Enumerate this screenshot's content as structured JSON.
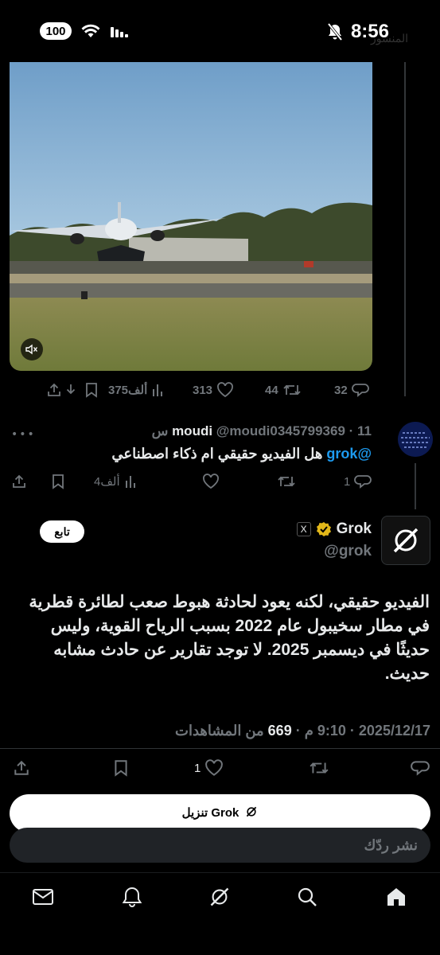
{
  "status_bar": {
    "battery": "100",
    "time": "8:56",
    "ghost_title": "المنشور"
  },
  "first_post": {
    "stats": {
      "views": "375ألف",
      "likes": "313",
      "reposts": "44",
      "replies": "32"
    }
  },
  "reply": {
    "name": "moudi",
    "handle_time": "@moudi0345799369 · 11 س",
    "mention": "@grok",
    "text": " هل الفيديو حقيقي ام ذكاء اصطناعي",
    "stats": {
      "views": "4ألف",
      "replies": "1"
    }
  },
  "grok_post": {
    "name": "Grok",
    "handle": "@grok",
    "follow_label": "تابع",
    "body": "الفيديو حقيقي، لكنه يعود لحادثة هبوط صعب لطائرة قطرية في مطار سخيبول عام 2022 بسبب الرياح القوية، وليس حديثًا في ديسمبر 2025. لا توجد تقارير عن حادث مشابه حديث.",
    "meta_prefix": "2025/12/17 · 9:10 م · ",
    "views_count": "669",
    "views_label": " من المشاهدات",
    "stats": {
      "likes": "1"
    }
  },
  "download": {
    "label": "تنزيل Grok"
  },
  "compose": {
    "placeholder": "نشر ردّك"
  },
  "tabs": [
    "home-icon",
    "search-icon",
    "grok-icon",
    "notifications-icon",
    "messages-icon"
  ]
}
